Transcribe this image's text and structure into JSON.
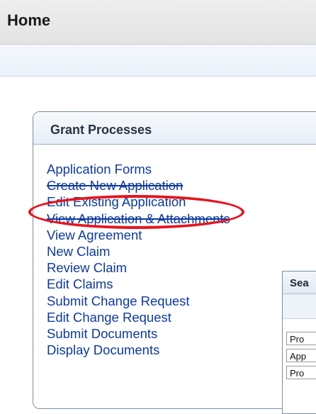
{
  "header": {
    "title": "Home"
  },
  "grant_processes": {
    "title": "Grant Processes",
    "links": [
      "Application Forms",
      "Create New Application",
      "Edit Existing Application",
      "View Application & Attachments",
      "View Agreement",
      "New Claim",
      "Review Claim",
      "Edit Claims",
      "Submit Change Request",
      "Edit Change Request",
      "Submit Documents",
      "Display Documents"
    ]
  },
  "search_panel": {
    "title": "Sea",
    "fields": [
      "Pro",
      "App",
      "Pro"
    ]
  },
  "colors": {
    "link": "#0b3aa8",
    "highlight": "#e8141b",
    "panel_border": "#7a8fa6"
  }
}
